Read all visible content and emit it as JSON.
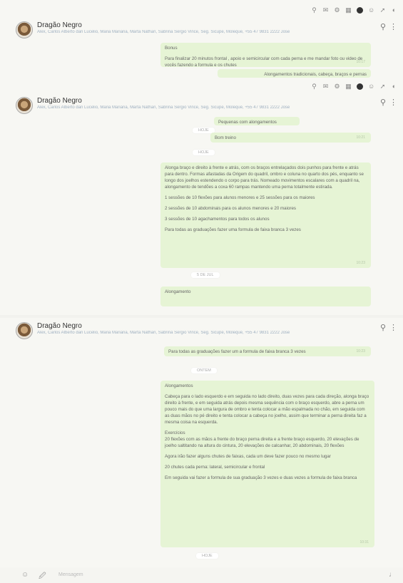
{
  "status_icons": [
    "⚲",
    "✉",
    "⚙",
    "▦",
    "●",
    "☺",
    "➚",
    "◐"
  ],
  "panels": [
    {
      "title": "Dragão Negro",
      "subtitle": "Alex, Carlos Alberto dan Lucelio, Maria Mariana, Marta Nathan, Sabrina Sergio Vince, Seg. Sicupe, Moleque, +55 47 9831 2222 Jose",
      "messages": [
        {
          "lines": [
            "Bonus",
            "Para finalizar 20 minutos frontal , apoio e semicircular com cada perna e me mandar foto ou video de vocês fazendo a formula e os chutes"
          ],
          "time": "10:17"
        },
        {
          "lines": [
            "Alongamentos tradicionais, cabeça, braços e pernas"
          ],
          "time": ""
        }
      ]
    },
    {
      "title": "Dragão Negro",
      "subtitle": "Alex, Carlos Alberto dan Lucelio, Maria Mariana, Marta Nathan, Sabrina Sergio Vince, Seg. Sicupe, Moleque, +55 47 9831 2222 Jose",
      "messages": [
        {
          "lines": [
            "Pequenas com alongamentos"
          ],
          "time": ""
        },
        {
          "lines": [
            "Bom treino"
          ],
          "time": "10:21"
        },
        {
          "lines": [
            "Alonga braço e direito à frente e atrás, com os braços entrelaçados dois punhos para frente e atrás para dentro. Formas afastadas da Origem do quadril, ombro e coluna no quarto dos pés, enquanto se longo dos joelhos estendendo o corpo para trás. Nomeado movimentos escalares com a quadril na, alongamento de tendões a coxa 60 rampas mantendo uma perna totalmente estirada.",
            "1 sessões de 10 flexões para alunos menores e 25 sessões para os maiores",
            "2 sessões de 10 abdominais para os alunos menores e 20 maiores",
            "3 sessões de 10 agachamentos para todos os alunos",
            "Para todas as graduações fazer uma formula de faixa branca 3 vezes"
          ],
          "time": "10:23"
        },
        {
          "lines": [
            "Alongamento"
          ],
          "time": ""
        }
      ],
      "dates": [
        "HOJE",
        "5 DE JUL"
      ]
    },
    {
      "title": "Dragão Negro",
      "subtitle": "Alex, Carlos Alberto dan Lucelio, Maria Mariana, Marta Nathan, Sabrina Sergio Vince, Seg. Sicupe, Moleque, +55 47 9831 2222 Jose",
      "messages": [
        {
          "lines": [
            "Para todas as graduações fazer um a formula de faixa branca 3 vezes"
          ],
          "time": "10:23"
        },
        {
          "lines": [
            "Alongamentos",
            "Cabeça para o lado esquerdo e em seguida no lado direito, duas vezes para cada direção, alonga braço direito à frente, e em seguida atrás depois mesma sequência com o braço esquerdo, abre a perna um pouco mais do que uma largura de ombro e tenta colocar a mão espalmada no chão, em seguida com as duas mãos no pé direito e tenta colocar a cabeça no joelho, assim que terminar a perna direita faz a mesma coisa na esquerda.",
            "Exercícios",
            "20 flexões com as mãos a frente do braço perna direita e a frente braço esquerdo, 20 elevações de joelho saltitando na altura do cintura, 20 elevações de calcanhar, 20 abdominais, 20 flexões",
            "Agora irão fazer alguns chutes de faixas, cada um deve fazer pouco no mesmo lugar",
            "20 chutes cada perna: lateral, semicircular e frontal",
            "Em seguida vai fazer a formula de sua graduação 3 vezes e duas vezes a formula de faixa branca"
          ],
          "time": "10:31"
        }
      ],
      "dates": [
        "ONTEM",
        "HOJE"
      ]
    }
  ],
  "footer": {
    "placeholder": "Mensagem"
  }
}
